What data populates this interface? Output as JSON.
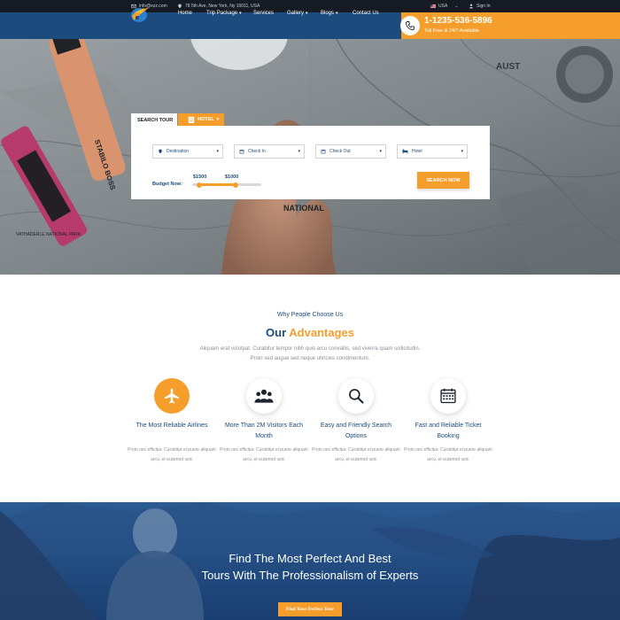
{
  "topbar": {
    "email": "info@ezz.com",
    "address": "78 5th Ave, New York, Ny 10011, USA",
    "language": "USA",
    "sign_in": "Sign In"
  },
  "nav": {
    "items": [
      {
        "label": "Home",
        "has_dropdown": false
      },
      {
        "label": "Trip Package",
        "has_dropdown": true
      },
      {
        "label": "Services",
        "has_dropdown": false
      },
      {
        "label": "Gallery",
        "has_dropdown": true
      },
      {
        "label": "Blogs",
        "has_dropdown": true
      },
      {
        "label": "Contact Us",
        "has_dropdown": false
      }
    ],
    "phone": "1-1235-536-5896",
    "phone_note": "Toll Free & 24/7 Available"
  },
  "search": {
    "tab_label": "SEARCH TOUR",
    "tab_hotel": "HOTEL",
    "fields": [
      {
        "label": "Destination",
        "icon": "map-pin-icon"
      },
      {
        "label": "Check In",
        "icon": "calendar-icon"
      },
      {
        "label": "Check Out",
        "icon": "calendar-icon"
      },
      {
        "label": "Hotel",
        "icon": "bed-icon"
      }
    ],
    "budget_label": "Budget Now:",
    "price_min": "$1500",
    "price_max": "$1000",
    "button": "SEARCH NOW"
  },
  "hero": {
    "marker_text": "STABILO BOSS",
    "map_labels": [
      "NATIONAL",
      "VATHADERLE NATIONAL PARK",
      "AUST"
    ]
  },
  "advantages": {
    "eyebrow": "Why People Choose Us",
    "title_plain": "Our",
    "title_highlight": "Advantages",
    "description": "Aliquam erat volutpat. Curabitur tempor nibh quis arcu convallis, sed viverra quam sollicitudin. Proin sed augue sed neque ultricies condimentum.",
    "features": [
      {
        "title": "The Most Reliable Airlines",
        "text": "Proin nec efficitur. Curabitur el puere aliquam arcu, et euismod sed.",
        "icon": "airplane-icon"
      },
      {
        "title": "More Than 2M Visitors Each Month",
        "text": "Proin nec efficitur. Curabitur el puere aliquam arcu, et euismod sed.",
        "icon": "users-icon"
      },
      {
        "title": "Easy and Friendly Search Options",
        "text": "Proin nec efficitur. Curabitur el puere aliquam arcu, et euismod sed.",
        "icon": "search-icon"
      },
      {
        "title": "Fast and Reliable Ticket Booking",
        "text": "Proin nec efficitur. Curabitur el puere aliquam arcu, et euismod sed.",
        "icon": "calendar-icon"
      }
    ]
  },
  "banner": {
    "line1": "Find The Most Perfect And Best",
    "line2": "Tours  With The Professionalism of Experts",
    "button": "Find Your Perfect Tour"
  },
  "colors": {
    "navy": "#1c4b7e",
    "orange": "#f59e2c",
    "topbar": "#161a22",
    "muted_text": "#8a8f99"
  }
}
